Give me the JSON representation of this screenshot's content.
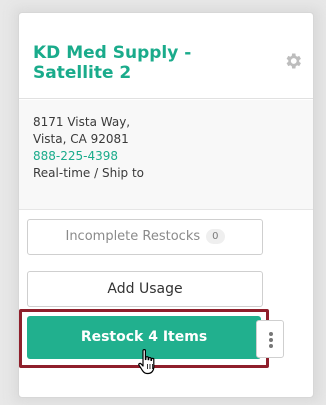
{
  "card": {
    "title": "KD Med Supply - Satellite 2",
    "address_line1": "8171 Vista Way,",
    "address_line2": "Vista, CA 92081",
    "phone": "888-225-4398",
    "type": "Real-time / Ship to"
  },
  "buttons": {
    "incomplete_label": "Incomplete Restocks",
    "incomplete_count": "0",
    "add_usage_label": "Add Usage",
    "restock_label": "Restock 4 Items"
  },
  "colors": {
    "accent": "#1aab8b",
    "primary_button": "#21b08e",
    "highlight": "#8f1f2b"
  },
  "icons": {
    "settings": "gear-icon",
    "more": "vertical-ellipsis-icon",
    "pointer": "hand-cursor-icon"
  }
}
